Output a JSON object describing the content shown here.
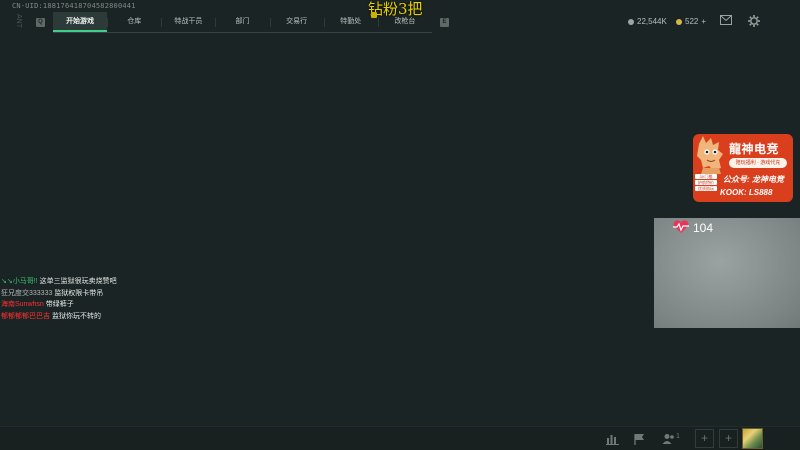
{
  "header": {
    "uid": "CN-UID:188176418704582800441",
    "side_mark": "ANT",
    "overlay_title": "钻粉3把",
    "left_key": "Q",
    "right_key": "E"
  },
  "nav": {
    "tabs": [
      {
        "label": "开始游戏",
        "active": true
      },
      {
        "label": "仓库",
        "active": false
      },
      {
        "label": "特战干员",
        "active": false
      },
      {
        "label": "部门",
        "active": false
      },
      {
        "label": "交易行",
        "active": false
      },
      {
        "label": "特勤处",
        "active": false
      },
      {
        "label": "改枪台",
        "active": false
      }
    ]
  },
  "currency": {
    "silver": "22,544K",
    "silver_color": "#9ea6a3",
    "gold": "522",
    "gold_color": "#d7b74a",
    "add_symbol": "+"
  },
  "icons": {
    "mail": "mail-icon",
    "settings": "gear-icon"
  },
  "sponsor": {
    "title": "龍神电竞",
    "pill": "陪玩福利 · 游戏代充",
    "tags": [
      "3X门槛",
      "护航特价",
      "优质陪玩"
    ],
    "line1": "公众号: 龙神电竞",
    "line2": "KOOK: LS888",
    "bg_color": "#d93f1d"
  },
  "stream": {
    "viewer_count": "104"
  },
  "chat": [
    {
      "user": "↘↘小马哥!!",
      "message": "这单三监狱很玩卖烧赞吧",
      "user_color": "#39c26b"
    },
    {
      "user": "狂兄度交333333",
      "message": "监狱权限卡带吊",
      "user_color": "#b0b8b5"
    },
    {
      "user": "海南Sunwhsn",
      "message": "带绿裤子",
      "user_color": "#ff3030"
    },
    {
      "user": "郁郁郁郁巴巴吉",
      "message": "监狱你玩不转的",
      "user_color": "#ff3030"
    }
  ],
  "bottom": {
    "team_count": "1",
    "plus_symbol": "+"
  }
}
